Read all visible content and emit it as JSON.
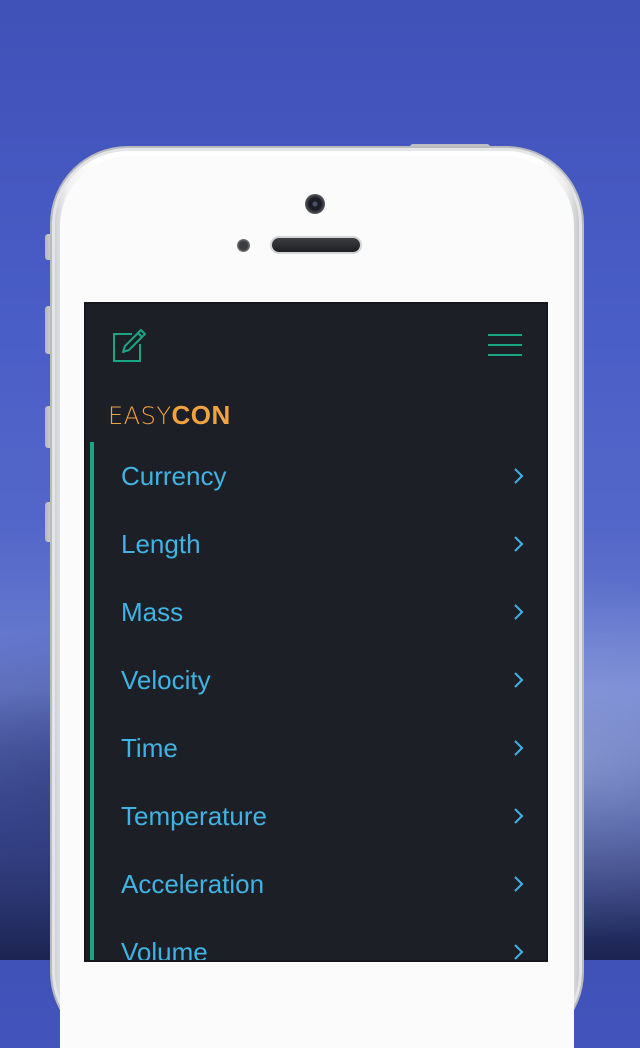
{
  "colors": {
    "background": "#4a5ec8",
    "screen": "#1d1f27",
    "accent": "#1aa684",
    "logo": "#f2a23f",
    "item_text": "#3fb3e3",
    "chevron": "#3fb3e3"
  },
  "header": {
    "left_icon": "edit-icon",
    "right_icon": "hamburger-menu-icon"
  },
  "logo": {
    "part1": "EASY",
    "part2": "CON"
  },
  "menu": {
    "items": [
      {
        "label": "Currency"
      },
      {
        "label": "Length"
      },
      {
        "label": "Mass"
      },
      {
        "label": "Velocity"
      },
      {
        "label": "Time"
      },
      {
        "label": "Temperature"
      },
      {
        "label": "Acceleration"
      },
      {
        "label": "Volume"
      }
    ]
  }
}
